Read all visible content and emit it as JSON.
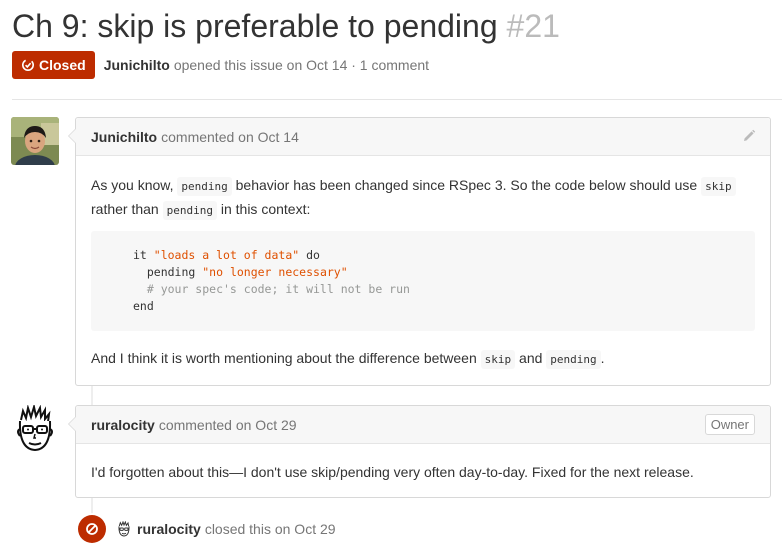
{
  "issue": {
    "title": "Ch 9: skip is preferable to pending",
    "number": "#21",
    "state": "Closed",
    "author": "Junichilto",
    "opened_text": "opened this issue on Oct 14 · 1 comment"
  },
  "comments": [
    {
      "author": "Junichilto",
      "meta": "commented on Oct 14",
      "body": {
        "p1_a": "As you know,",
        "p1_code1": "pending",
        "p1_b": "behavior has been changed since RSpec 3. So the code below should use",
        "p1_code2": "skip",
        "p1_c": "rather than",
        "p1_code3": "pending",
        "p1_d": "in this context:",
        "code_lines": {
          "l1_kw": "it ",
          "l1_str": "\"loads a lot of data\"",
          "l1_end": " do",
          "l2_kw": "  pending ",
          "l2_str": "\"no longer necessary\"",
          "l3_comment": "  # your spec's code; it will not be run",
          "l4": "end"
        },
        "p2_a": "And I think it is worth mentioning about the difference between",
        "p2_code1": "skip",
        "p2_b": "and",
        "p2_code2": "pending",
        "p2_c": "."
      }
    },
    {
      "author": "ruralocity",
      "meta": "commented on Oct 29",
      "badge": "Owner",
      "body": "I'd forgotten about this—I don't use skip/pending very often day-to-day. Fixed for the next release."
    }
  ],
  "event": {
    "actor": "ruralocity",
    "text": "closed this on Oct 29"
  },
  "colors": {
    "closed_red": "#bd2c00",
    "header_bg": "#f7f7f7",
    "border": "#d8d8d8",
    "string": "#df5000",
    "comment": "#969896"
  },
  "icons": {
    "closed_badge": "issue-closed-icon",
    "edit": "pencil-icon",
    "event": "circle-slash-icon"
  }
}
